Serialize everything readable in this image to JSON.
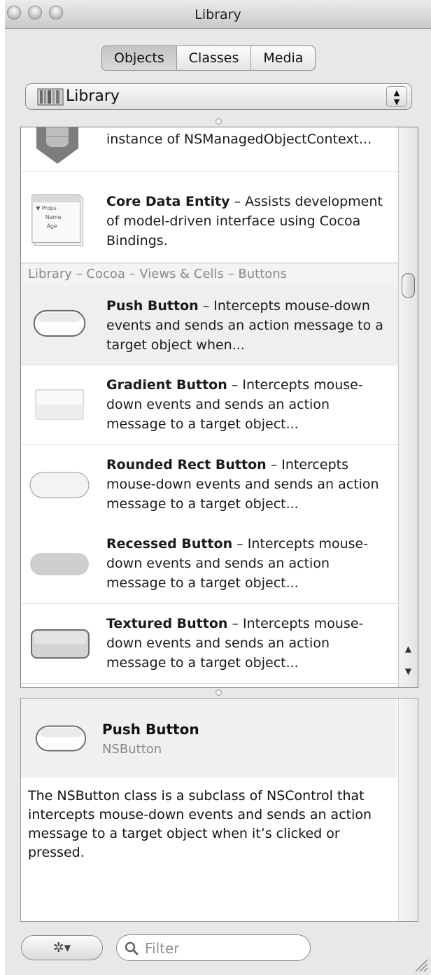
{
  "window": {
    "title": "Library"
  },
  "segments": [
    {
      "label": "Objects",
      "active": true
    },
    {
      "label": "Classes",
      "active": false
    },
    {
      "label": "Media",
      "active": false
    }
  ],
  "library_popup": {
    "value": "Library",
    "icon": "book-icon"
  },
  "list": {
    "items_top": [
      {
        "title": "",
        "text": "instance of NSManagedObjectContext...",
        "icon": "managed-object-context-icon"
      },
      {
        "title": "Core Data Entity",
        "text": " – Assists development of model-driven interface using Cocoa Bindings.",
        "icon": "core-data-entity-icon",
        "icon_labels": [
          "▼ Props",
          "Name",
          "Age"
        ]
      }
    ],
    "section_header": "Library – Cocoa – Views & Cells – Buttons",
    "items": [
      {
        "title": "Push Button",
        "text": " – Intercepts mouse-down events and sends an action message to a target object when...",
        "icon": "push-button-icon",
        "selected": true
      },
      {
        "title": "Gradient Button",
        "text": " – Intercepts mouse-down events and sends an action message to a target object...",
        "icon": "gradient-button-icon",
        "selected": false
      },
      {
        "title": "Rounded Rect Button",
        "text": " – Intercepts mouse-down events and sends an action message to a target object...",
        "icon": "rounded-rect-button-icon",
        "selected": false
      },
      {
        "title": "Recessed Button",
        "text": " – Intercepts mouse-down events and sends an action message to a target object...",
        "icon": "recessed-button-icon",
        "selected": false
      },
      {
        "title": "Textured Button",
        "text": " – Intercepts mouse-down events and sends an action message to a target object...",
        "icon": "textured-button-icon",
        "selected": false
      }
    ]
  },
  "detail": {
    "name": "Push Button",
    "class_name": "NSButton",
    "description": "The NSButton class is a subclass of NSControl that intercepts mouse-down events and sends an action message to a target object when it’s clicked or pressed."
  },
  "bottom_bar": {
    "action_icon": "gear-icon",
    "action_glyph": "✲▾",
    "filter_placeholder": "Filter",
    "filter_value": ""
  }
}
